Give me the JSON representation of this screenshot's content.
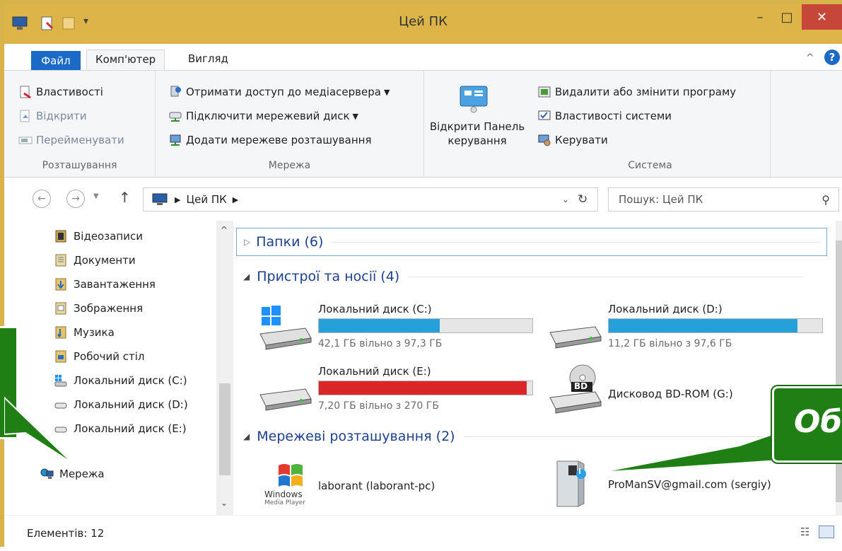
{
  "window": {
    "title": "Цей ПК",
    "minimize": "–",
    "maximize": "□",
    "close": "✕"
  },
  "tabs": {
    "file": "Файл",
    "computer": "Комп'ютер",
    "view": "Вигляд"
  },
  "ribbon": {
    "location": {
      "label": "Розташування",
      "properties": "Властивості",
      "open": "Відкрити",
      "rename": "Перейменувати"
    },
    "network": {
      "label": "Мережа",
      "media": "Отримати доступ до медіасервера",
      "map_drive": "Підключити мережевий диск",
      "add_location": "Додати мережеве розташування"
    },
    "control_panel": {
      "line1": "Відкрити Панель",
      "line2": "керування"
    },
    "system": {
      "label": "Система",
      "uninstall": "Видалити або змінити програму",
      "sys_props": "Властивості системи",
      "manage": "Керувати"
    }
  },
  "address": {
    "path_item": "Цей ПК",
    "search_placeholder": "Пошук: Цей ПК"
  },
  "nav": {
    "items": [
      "Відеозаписи",
      "Документи",
      "Завантаження",
      "Зображення",
      "Музика",
      "Робочий стіл",
      "Локальний диск (C:)",
      "Локальний диск (D:)",
      "Локальний диск (E:)"
    ],
    "network": "Мережа"
  },
  "content": {
    "folders_header": "Папки (6)",
    "devices_header": "Пристрої та носії (4)",
    "network_header": "Мережеві розташування (2)",
    "drives": [
      {
        "name": "Локальний диск (C:)",
        "free": "42,1 ГБ вільно з 97,3 ГБ",
        "used_fraction": 0.567,
        "color": "#26a0da"
      },
      {
        "name": "Локальний диск (D:)",
        "free": "11,2 ГБ вільно з 97,6 ГБ",
        "used_fraction": 0.885,
        "color": "#26a0da"
      },
      {
        "name": "Локальний диск (E:)",
        "free": "7,20 ГБ вільно з 270 ГБ",
        "used_fraction": 0.973,
        "color": "#da2626"
      }
    ],
    "bdrom": "Дисковод BD-ROM (G:)",
    "bd_label": "BD",
    "net_locations": [
      "laborant (laborant-pc)",
      "ProManSV@gmail.com (sergiy)"
    ],
    "wmp_line1": "Windows",
    "wmp_line2": "Media Player"
  },
  "status": {
    "count": "Елементів: 12"
  },
  "callouts": {
    "right_text": "Об"
  }
}
